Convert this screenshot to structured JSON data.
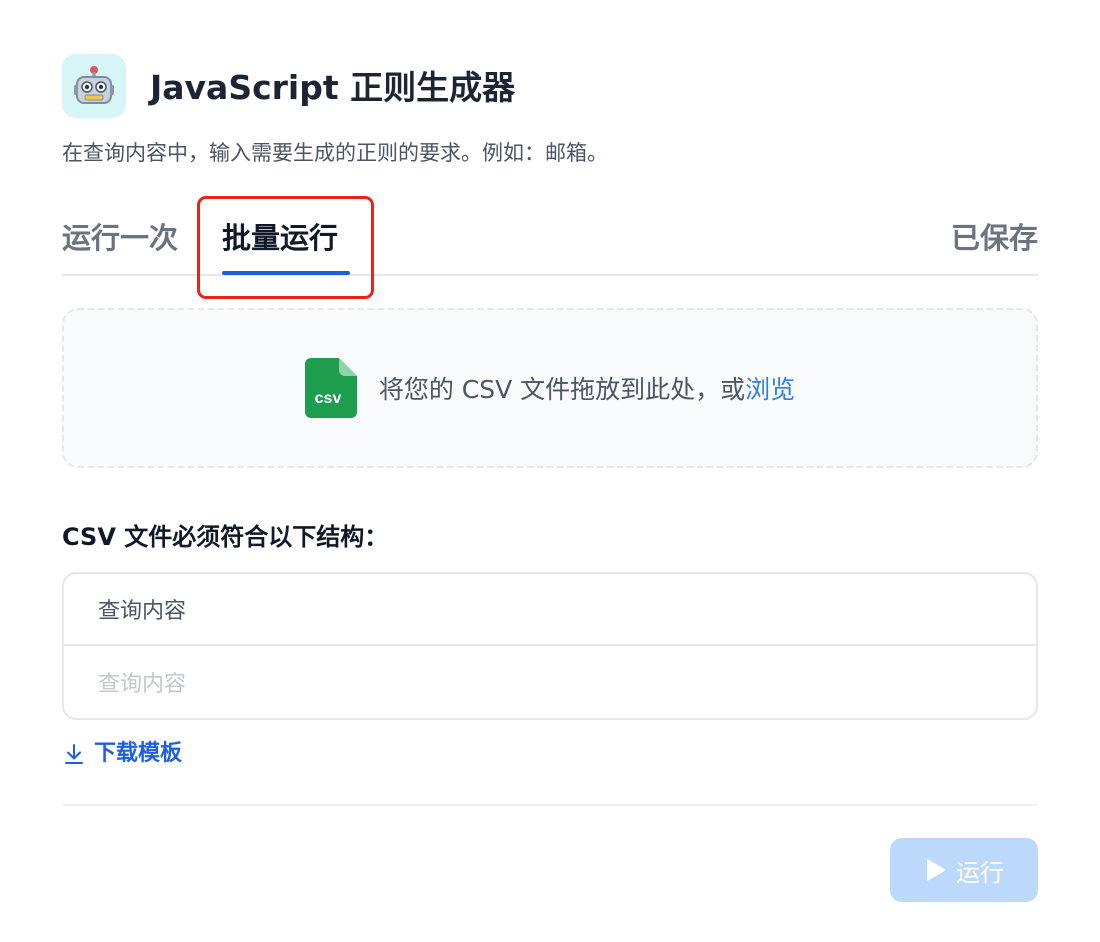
{
  "header": {
    "icon": "robot-icon",
    "title": "JavaScript 正则生成器",
    "description": "在查询内容中，输入需要生成的正则的要求。例如：邮箱。"
  },
  "tabs": {
    "run_once": "运行一次",
    "batch_run": "批量运行",
    "saved": "已保存",
    "active": "batch_run"
  },
  "dropzone": {
    "icon": "csv-file-icon",
    "icon_text": "csv",
    "text": "将您的 CSV 文件拖放到此处，或",
    "browse_label": "浏览"
  },
  "structure": {
    "title": "CSV 文件必须符合以下结构：",
    "header_cell": "查询内容",
    "placeholder_cell": "查询内容"
  },
  "download": {
    "icon": "download-icon",
    "label": "下载模板"
  },
  "run_button": {
    "icon": "play-icon",
    "label": "运行",
    "disabled": true
  },
  "colors": {
    "accent": "#1d5fe0",
    "link": "#2f7ee8",
    "highlight": "#e8231b",
    "disabled_button": "#bcd8fb",
    "csv_icon": "#1f9d4f"
  }
}
